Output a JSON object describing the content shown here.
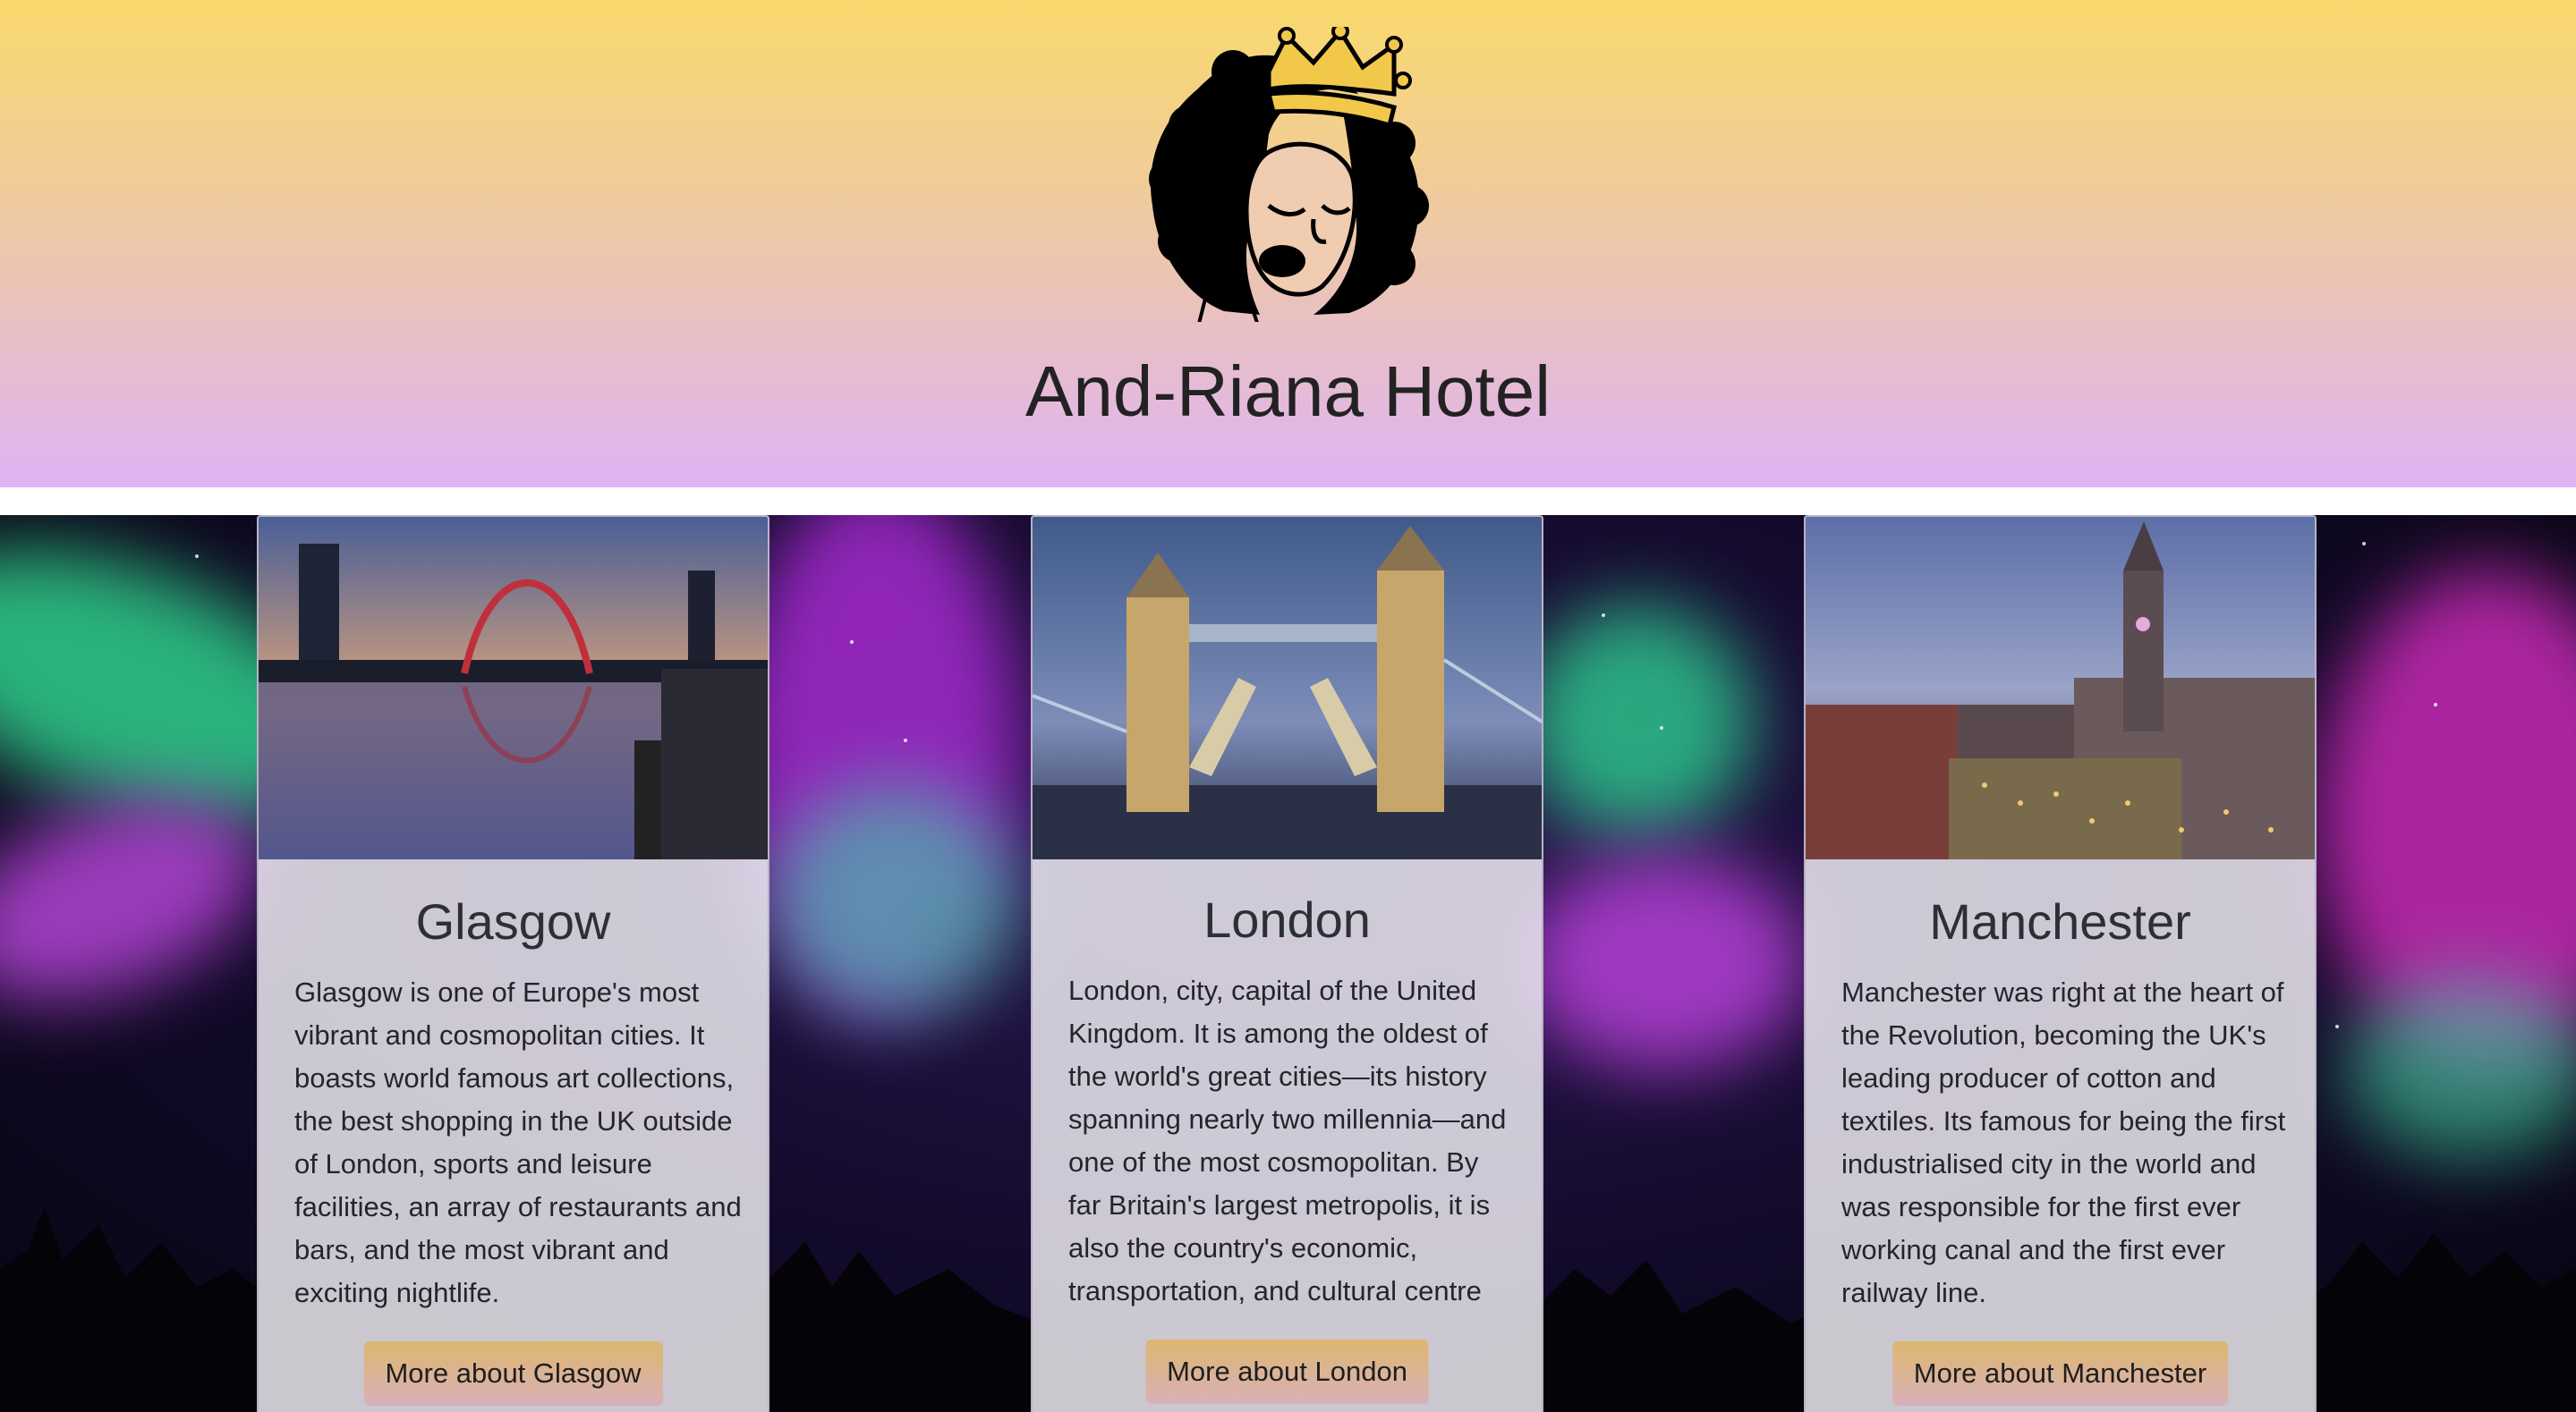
{
  "header": {
    "logo_icon": "crowned-woman-afro-logo",
    "title": "And-Riana Hotel"
  },
  "hero": {
    "background": "aurora-night-sky"
  },
  "cards": [
    {
      "image": "glasgow-clyde-arc-photo",
      "title": "Glasgow",
      "text": "Glasgow is one of Europe's most vibrant and cosmopolitan cities. It boasts world famous art collections, the best shopping in the UK outside of London, sports and leisure facilities, an array of restaurants and bars, and the most vibrant and exciting nightlife.",
      "button": "More about Glasgow"
    },
    {
      "image": "london-tower-bridge-photo",
      "title": "London",
      "text": "London, city, capital of the United Kingdom. It is among the oldest of the world's great cities—its history spanning nearly two millennia—and one of the most cosmopolitan. By far Britain's largest metropolis, it is also the country's economic, transportation, and cultural centre",
      "button": "More about London"
    },
    {
      "image": "manchester-town-hall-photo",
      "title": "Manchester",
      "text": "Manchester was right at the heart of the Revolution, becoming the UK's leading producer of cotton and textiles. Its famous for being the first industrialised city in the world and was responsible for the first ever working canal and the first ever railway line.",
      "button": "More about Manchester"
    }
  ],
  "colors": {
    "header_top": "#f9d96c",
    "header_bottom": "#dfb3f4",
    "button_top": "#ddb76f",
    "button_bottom": "#d9b0b9"
  }
}
